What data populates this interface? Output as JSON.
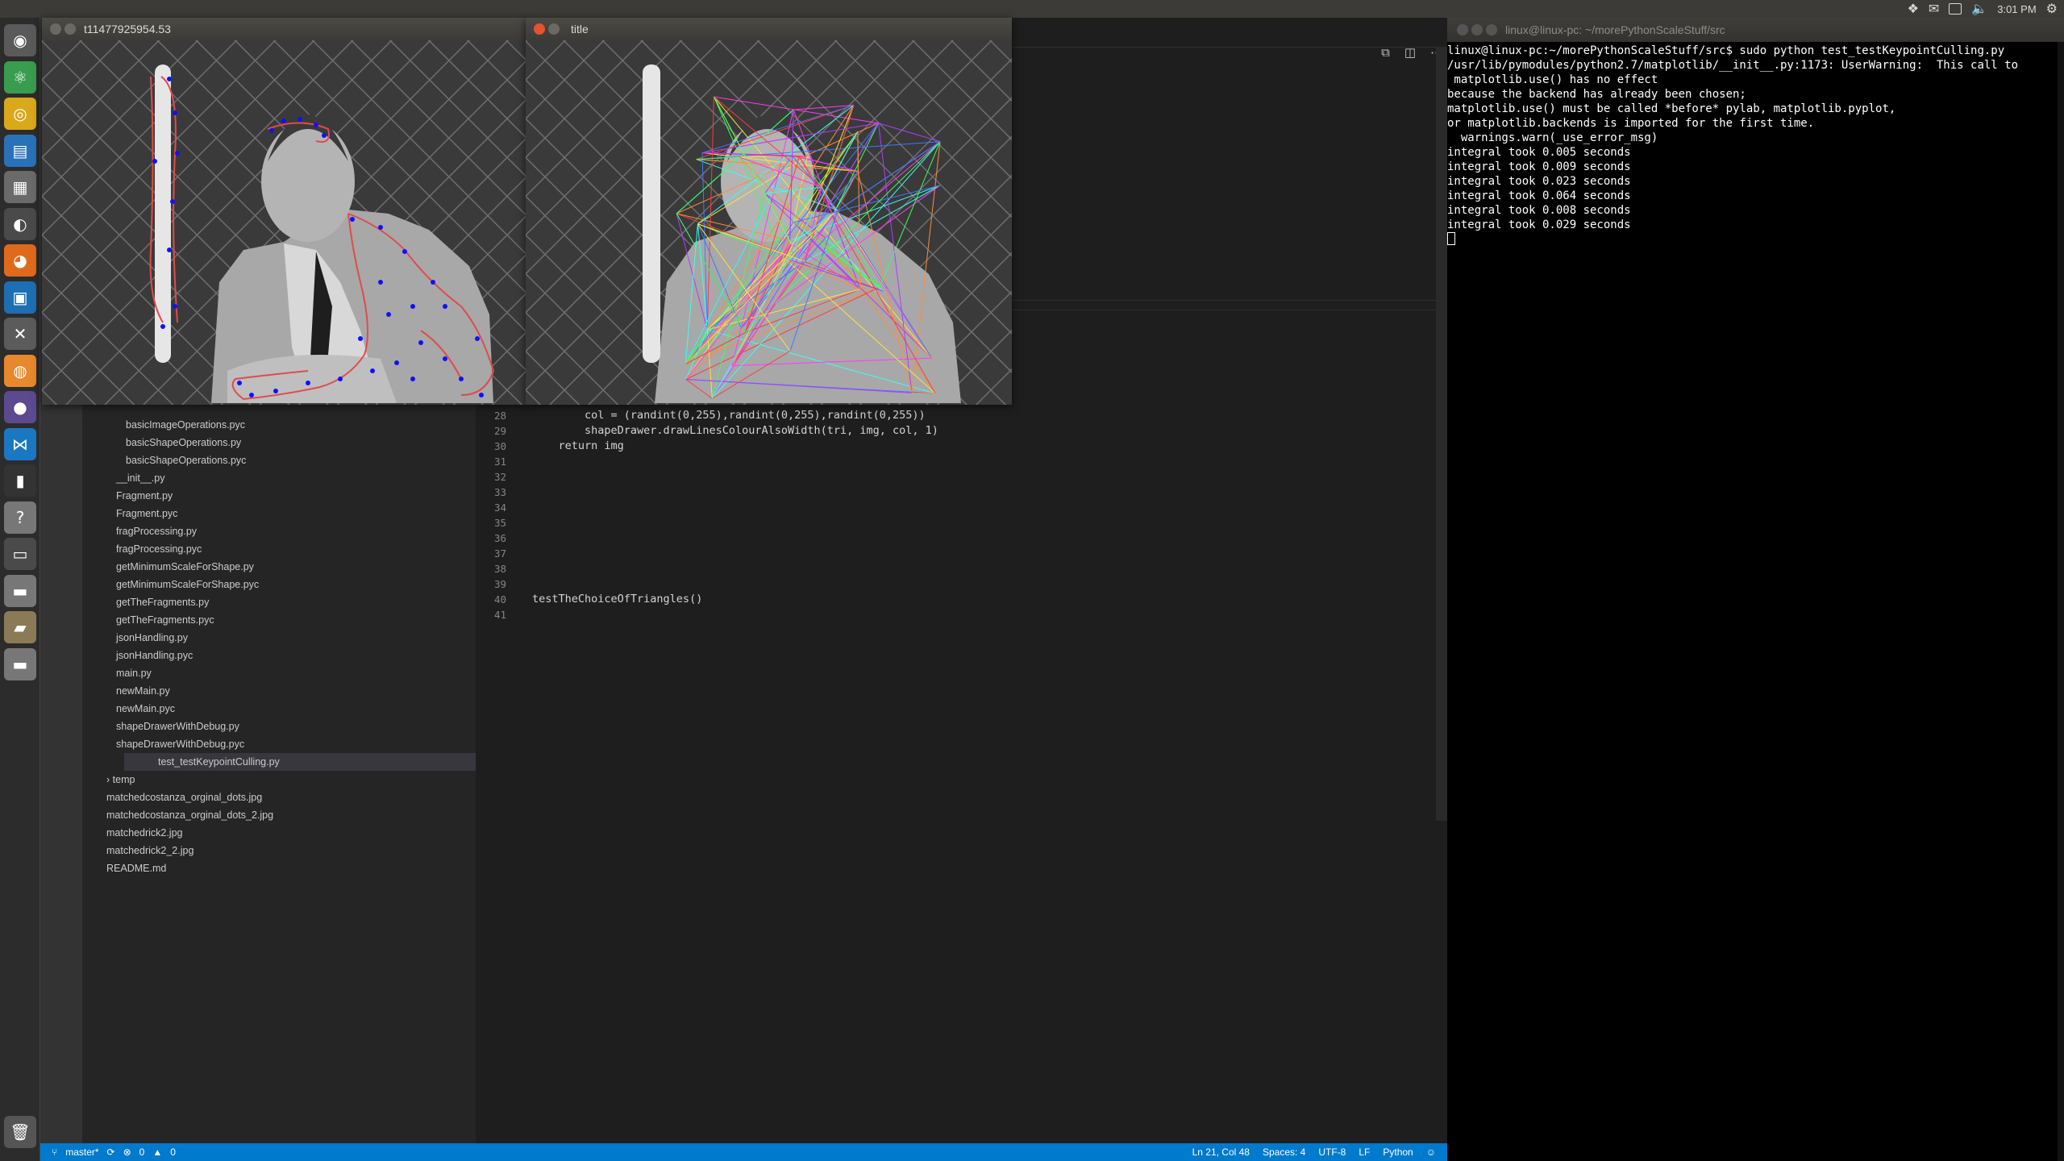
{
  "top_panel": {
    "clock": "3:01 PM"
  },
  "launcher": {
    "items": [
      {
        "name": "dash-icon",
        "glyph": "◉",
        "color": "#5a5a5a"
      },
      {
        "name": "atom-icon",
        "glyph": "⚛",
        "color": "#3a9c4e"
      },
      {
        "name": "chrome-icon",
        "glyph": "◎",
        "color": "#d9a81b"
      },
      {
        "name": "writer-icon",
        "glyph": "▤",
        "color": "#2a72b8"
      },
      {
        "name": "files-icon",
        "glyph": "▦",
        "color": "#6a6a6a"
      },
      {
        "name": "steam-icon",
        "glyph": "◐",
        "color": "#4a4a4a"
      },
      {
        "name": "firefox-icon",
        "glyph": "◕",
        "color": "#e06a1b"
      },
      {
        "name": "remote-icon",
        "glyph": "▣",
        "color": "#1d6fb3"
      },
      {
        "name": "tools-icon",
        "glyph": "✕",
        "color": "#5b5b5b"
      },
      {
        "name": "blender-icon",
        "glyph": "◍",
        "color": "#e8872b"
      },
      {
        "name": "eclipse-icon",
        "glyph": "●",
        "color": "#5b4a8f"
      },
      {
        "name": "vscode-icon",
        "glyph": "⋈",
        "color": "#1a78c2"
      },
      {
        "name": "terminal-icon",
        "glyph": "▮",
        "color": "#333333"
      },
      {
        "name": "help-icon",
        "glyph": "?",
        "color": "#777777"
      },
      {
        "name": "desktop-icon",
        "glyph": "▭",
        "color": "#4a4a4a"
      },
      {
        "name": "drive-icon",
        "glyph": "▬",
        "color": "#777777"
      },
      {
        "name": "folder-icon",
        "glyph": "▰",
        "color": "#8a7a55"
      },
      {
        "name": "drive2-icon",
        "glyph": "▬",
        "color": "#777777"
      },
      {
        "name": "trash-icon",
        "glyph": "🗑",
        "color": "#555555"
      }
    ]
  },
  "explorer": {
    "items": [
      {
        "label": "basicImageOperations.pyc",
        "indent": 2
      },
      {
        "label": "basicShapeOperations.py",
        "indent": 2
      },
      {
        "label": "basicShapeOperations.pyc",
        "indent": 2
      },
      {
        "label": "__init__.py",
        "indent": 1
      },
      {
        "label": "Fragment.py",
        "indent": 1
      },
      {
        "label": "Fragment.pyc",
        "indent": 1
      },
      {
        "label": "fragProcessing.py",
        "indent": 1
      },
      {
        "label": "fragProcessing.pyc",
        "indent": 1
      },
      {
        "label": "getMinimumScaleForShape.py",
        "indent": 1
      },
      {
        "label": "getMinimumScaleForShape.pyc",
        "indent": 1
      },
      {
        "label": "getTheFragments.py",
        "indent": 1
      },
      {
        "label": "getTheFragments.pyc",
        "indent": 1
      },
      {
        "label": "jsonHandling.py",
        "indent": 1
      },
      {
        "label": "jsonHandling.pyc",
        "indent": 1
      },
      {
        "label": "main.py",
        "indent": 1
      },
      {
        "label": "newMain.py",
        "indent": 1
      },
      {
        "label": "newMain.pyc",
        "indent": 1
      },
      {
        "label": "shapeDrawerWithDebug.py",
        "indent": 1
      },
      {
        "label": "shapeDrawerWithDebug.pyc",
        "indent": 1
      },
      {
        "label": "test_testKeypointCulling.py",
        "indent": 1,
        "selected": true
      },
      {
        "label": "temp",
        "indent": 0,
        "folder": true
      },
      {
        "label": "matchedcostanza_orginal_dots.jpg",
        "indent": 0
      },
      {
        "label": "matchedcostanza_orginal_dots_2.jpg",
        "indent": 0
      },
      {
        "label": "matchedrick2.jpg",
        "indent": 0
      },
      {
        "label": "matchedrick2_2.jpg",
        "indent": 0
      },
      {
        "label": "README.md",
        "indent": 0
      }
    ]
  },
  "editor": {
    "lines": [
      {
        "n": "28",
        "code": "        col = (randint(0,255),randint(0,255),randint(0,255))"
      },
      {
        "n": "29",
        "code": "        shapeDrawer.drawLinesColourAlsoWidth(tri, img, col, 1)"
      },
      {
        "n": "30",
        "code": "    return img"
      },
      {
        "n": "31",
        "code": ""
      },
      {
        "n": "32",
        "code": ""
      },
      {
        "n": "33",
        "code": ""
      },
      {
        "n": "34",
        "code": ""
      },
      {
        "n": "35",
        "code": ""
      },
      {
        "n": "36",
        "code": ""
      },
      {
        "n": "37",
        "code": ""
      },
      {
        "n": "38",
        "code": ""
      },
      {
        "n": "39",
        "code": ""
      },
      {
        "n": "40",
        "code": "testTheChoiceOfTriangles()"
      },
      {
        "n": "41",
        "code": ""
      }
    ]
  },
  "statusbar": {
    "branch": "master*",
    "errors": "0",
    "warnings": "0",
    "position": "Ln 21, Col 48",
    "spaces": "Spaces: 4",
    "encoding": "UTF-8",
    "eol": "LF",
    "language": "Python"
  },
  "image_window_left": {
    "title": "t11477925954.53"
  },
  "image_window_right": {
    "title": "title"
  },
  "terminal": {
    "title": "linux@linux-pc: ~/morePythonScaleStuff/src",
    "lines": [
      "linux@linux-pc:~/morePythonScaleStuff/src$ sudo python test_testKeypointCulling.py",
      "/usr/lib/pymodules/python2.7/matplotlib/__init__.py:1173: UserWarning:  This call to",
      " matplotlib.use() has no effect",
      "because the backend has already been chosen;",
      "matplotlib.use() must be called *before* pylab, matplotlib.pyplot,",
      "or matplotlib.backends is imported for the first time.",
      "",
      "  warnings.warn(_use_error_msg)",
      "integral took 0.005 seconds",
      "integral took 0.009 seconds",
      "integral took 0.023 seconds",
      "integral took 0.064 seconds",
      "integral took 0.008 seconds",
      "integral took 0.029 seconds"
    ]
  }
}
